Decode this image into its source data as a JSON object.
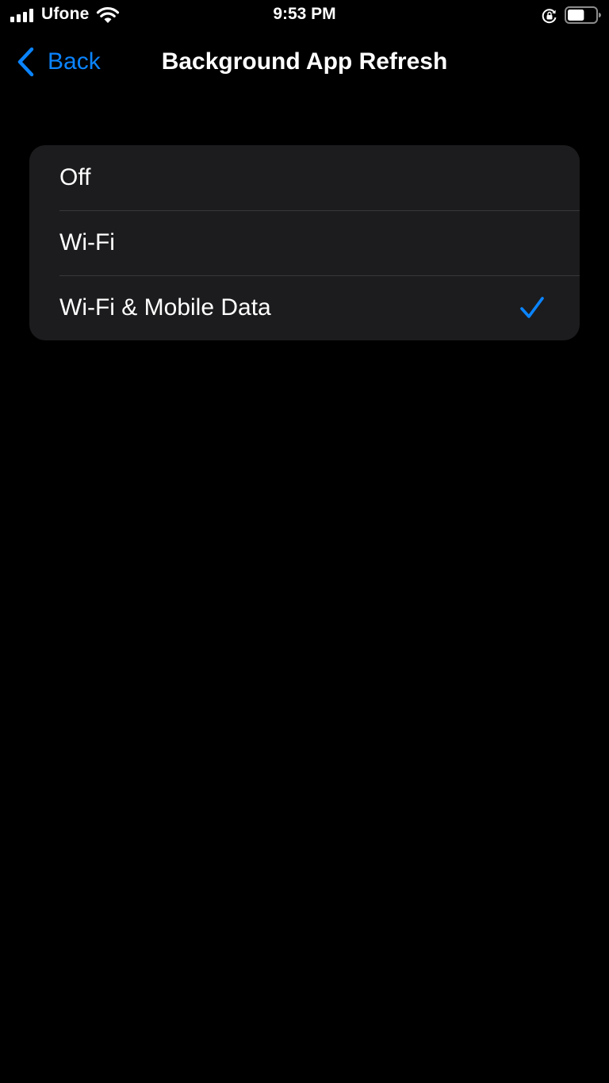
{
  "status_bar": {
    "carrier": "Ufone",
    "time": "9:53 PM",
    "signal_icon": "cellular-signal-icon",
    "wifi_icon": "wifi-icon",
    "orientation_lock_icon": "orientation-lock-icon",
    "battery_icon": "battery-icon",
    "battery_level": 0.6
  },
  "nav": {
    "back_label": "Back",
    "back_icon": "chevron-left-icon",
    "title": "Background App Refresh"
  },
  "options": [
    {
      "label": "Off",
      "selected": false
    },
    {
      "label": "Wi-Fi",
      "selected": false
    },
    {
      "label": "Wi-Fi & Mobile Data",
      "selected": true
    }
  ],
  "colors": {
    "background": "#000000",
    "group_background": "#1c1c1e",
    "separator": "#38383a",
    "accent": "#0a84ff",
    "text": "#ffffff"
  }
}
